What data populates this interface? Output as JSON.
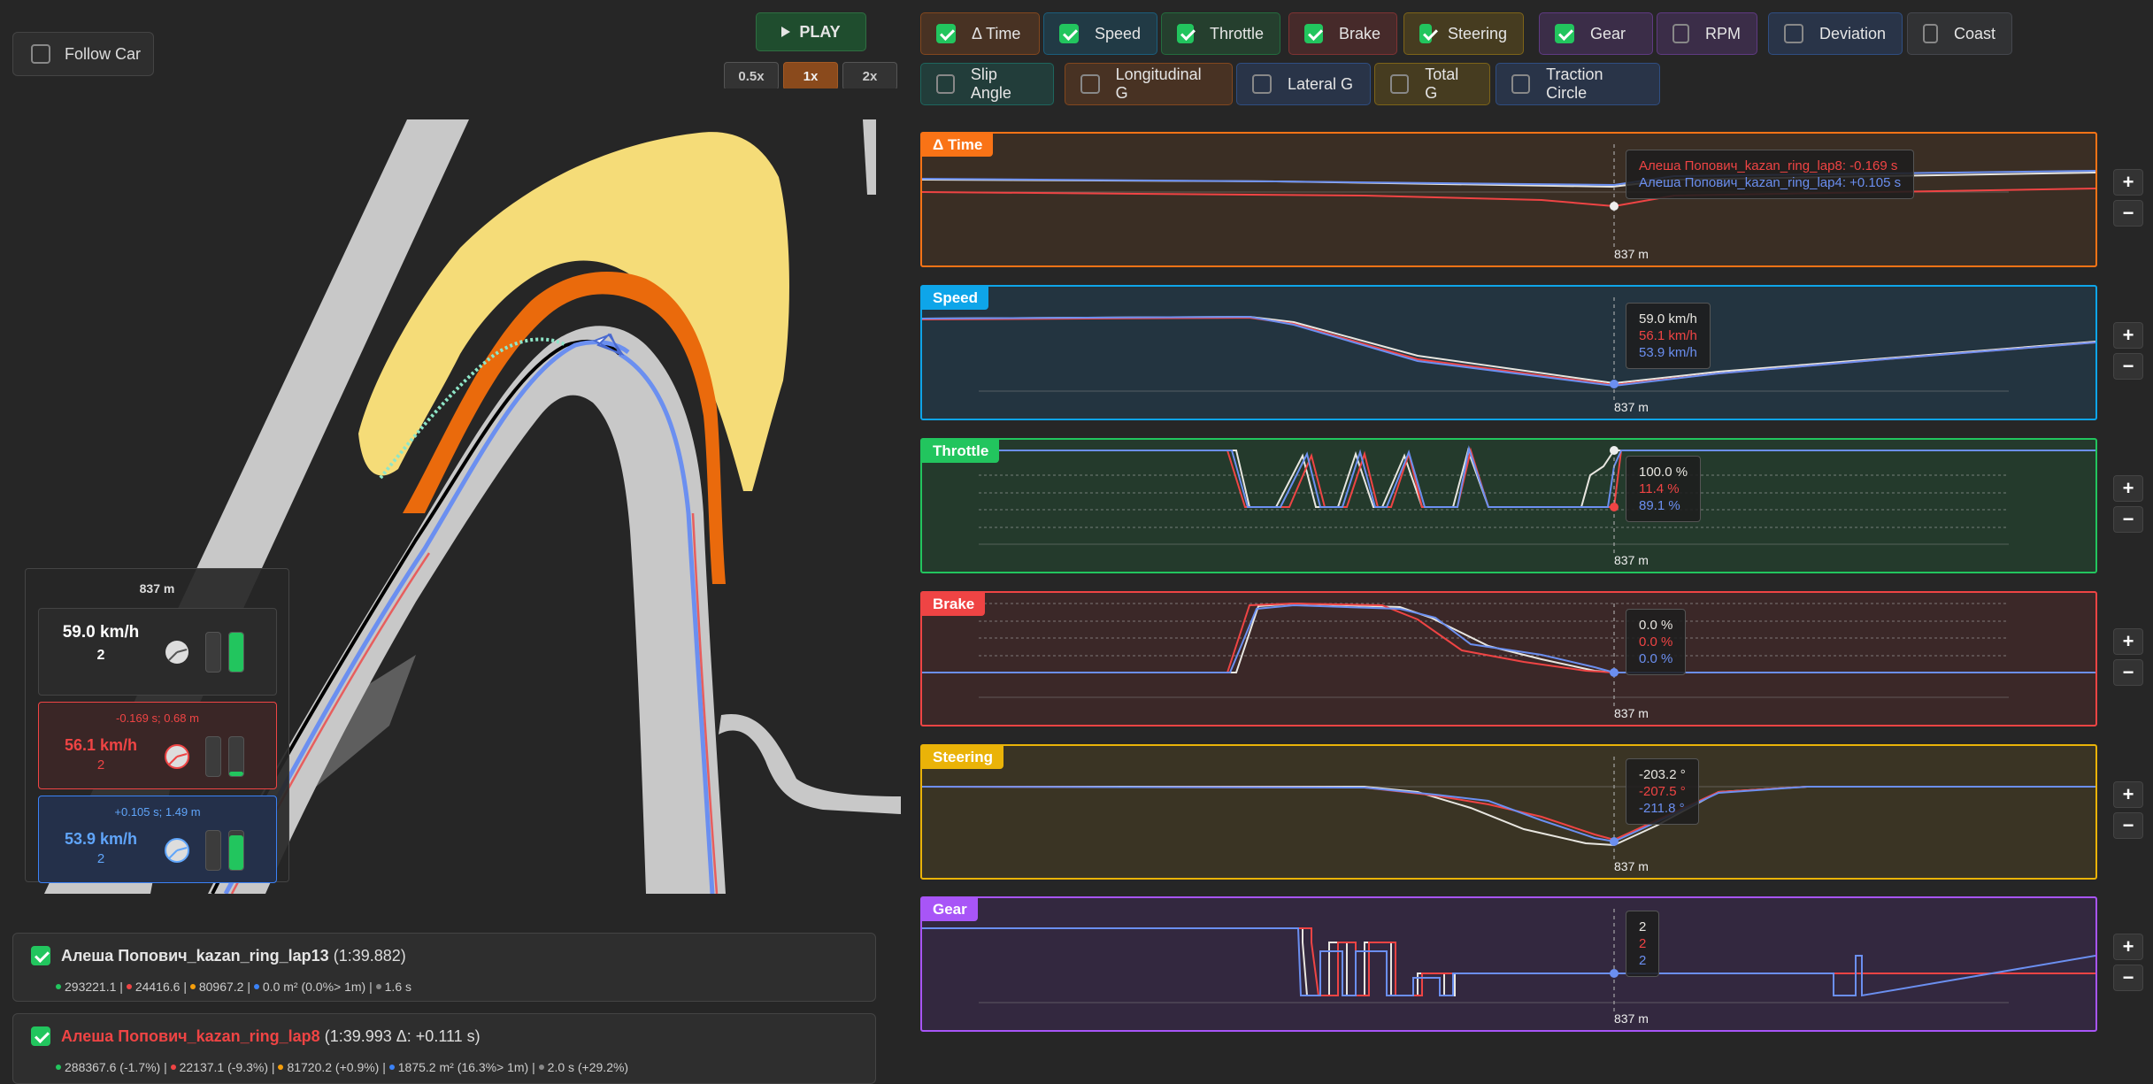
{
  "follow_car": {
    "label": "Follow Car",
    "checked": false
  },
  "play": {
    "label": "PLAY",
    "icon": "play-icon"
  },
  "speeds": [
    "0.5x",
    "1x",
    "2x"
  ],
  "active_speed": "1x",
  "toggles": [
    {
      "label": "Δ Time",
      "checked": true,
      "color": "#f97316"
    },
    {
      "label": "Speed",
      "checked": true,
      "color": "#0ea5e9"
    },
    {
      "label": "Throttle",
      "checked": true,
      "color": "#22c55e"
    },
    {
      "label": "Brake",
      "checked": true,
      "color": "#ef4444"
    },
    {
      "label": "Steering",
      "checked": true,
      "color": "#eab308"
    },
    {
      "label": "Gear",
      "checked": true,
      "color": "#a855f7"
    },
    {
      "label": "RPM",
      "checked": false,
      "color": "#a855f7"
    },
    {
      "label": "Deviation",
      "checked": false,
      "color": "#3b82f6"
    },
    {
      "label": "Coast",
      "checked": false,
      "color": "#6b7280"
    },
    {
      "label": "Slip Angle",
      "checked": false,
      "color": "#14b8a6"
    },
    {
      "label": "Longitudinal G",
      "checked": false,
      "color": "#f97316"
    },
    {
      "label": "Lateral G",
      "checked": false,
      "color": "#3b82f6"
    },
    {
      "label": "Total G",
      "checked": false,
      "color": "#eab308"
    },
    {
      "label": "Traction Circle",
      "checked": false,
      "color": "#3b82f6"
    }
  ],
  "overlay": {
    "distance": "837 m",
    "main": {
      "speed": "59.0 km/h",
      "gear": "2",
      "throttle": 1.0,
      "brake": 0.0
    },
    "cmp1": {
      "delta": "-0.169 s; 0.68 m",
      "speed": "56.1 km/h",
      "gear": "2",
      "throttle": 0.114,
      "brake": 0.0,
      "color": "#ef4444"
    },
    "cmp2": {
      "delta": "+0.105 s; 1.49 m",
      "speed": "53.9 km/h",
      "gear": "2",
      "throttle": 0.891,
      "brake": 0.0,
      "color": "#60a5fa"
    }
  },
  "laps": [
    {
      "name": "Алеша Попович_kazan_ring_lap13",
      "time": "(1:39.882)",
      "checked": true,
      "color": "#e5e5e5",
      "stats": [
        {
          "c": "#22c55e",
          "t": "293221.1"
        },
        {
          "c": "#ef4444",
          "t": "24416.6"
        },
        {
          "c": "#f59e0b",
          "t": "80967.2"
        },
        {
          "c": "#3b82f6",
          "t": "0.0 m² (0.0%> 1m)"
        },
        {
          "c": "#888",
          "t": "1.6 s"
        }
      ]
    },
    {
      "name": "Алеша Попович_kazan_ring_lap8",
      "time": "(1:39.993 Δ: +0.111 s)",
      "checked": true,
      "color": "#ef4444",
      "stats": [
        {
          "c": "#22c55e",
          "t": "288367.6 (-1.7%)"
        },
        {
          "c": "#ef4444",
          "t": "22137.1 (-9.3%)"
        },
        {
          "c": "#f59e0b",
          "t": "81720.2 (+0.9%)"
        },
        {
          "c": "#3b82f6",
          "t": "1875.2 m² (16.3%> 1m)"
        },
        {
          "c": "#888",
          "t": "2.0 s (+29.2%)"
        }
      ]
    }
  ],
  "panels": [
    {
      "key": "dtime",
      "title": "Δ Time",
      "color": "#f97316",
      "bg": "#3a2e24",
      "cursor_label": "837 m",
      "tooltip": [
        "Алеша Попович_kazan_ring_lap8: -0.169 s",
        "Алеша Попович_kazan_ring_lap4: +0.105 s"
      ]
    },
    {
      "key": "speed",
      "title": "Speed",
      "color": "#0ea5e9",
      "bg": "#233440",
      "cursor_label": "837 m",
      "tooltip": [
        "59.0 km/h",
        "56.1 km/h",
        "53.9 km/h"
      ]
    },
    {
      "key": "throttle",
      "title": "Throttle",
      "color": "#22c55e",
      "bg": "#243a2c",
      "cursor_label": "837 m",
      "tooltip": [
        "100.0 %",
        "11.4 %",
        "89.1 %"
      ]
    },
    {
      "key": "brake",
      "title": "Brake",
      "color": "#ef4444",
      "bg": "#3b2828",
      "cursor_label": "837 m",
      "tooltip": [
        "0.0 %",
        "0.0 %",
        "0.0 %"
      ]
    },
    {
      "key": "steering",
      "title": "Steering",
      "color": "#eab308",
      "bg": "#3a3424",
      "cursor_label": "837 m",
      "tooltip": [
        "-203.2 °",
        "-207.5 °",
        "-211.8 °"
      ]
    },
    {
      "key": "gear",
      "title": "Gear",
      "color": "#a855f7",
      "bg": "#33283f",
      "cursor_label": "837 m",
      "tooltip": [
        "2",
        "2",
        "2"
      ]
    }
  ],
  "series_colors": {
    "main": "#e8e6e0",
    "cmp1": "#ef4444",
    "cmp2": "#6b8ff0"
  },
  "track_colors": {
    "track": "#c8c8c8",
    "kerb": "#ea6a0c",
    "sand": "#f5dc78"
  }
}
